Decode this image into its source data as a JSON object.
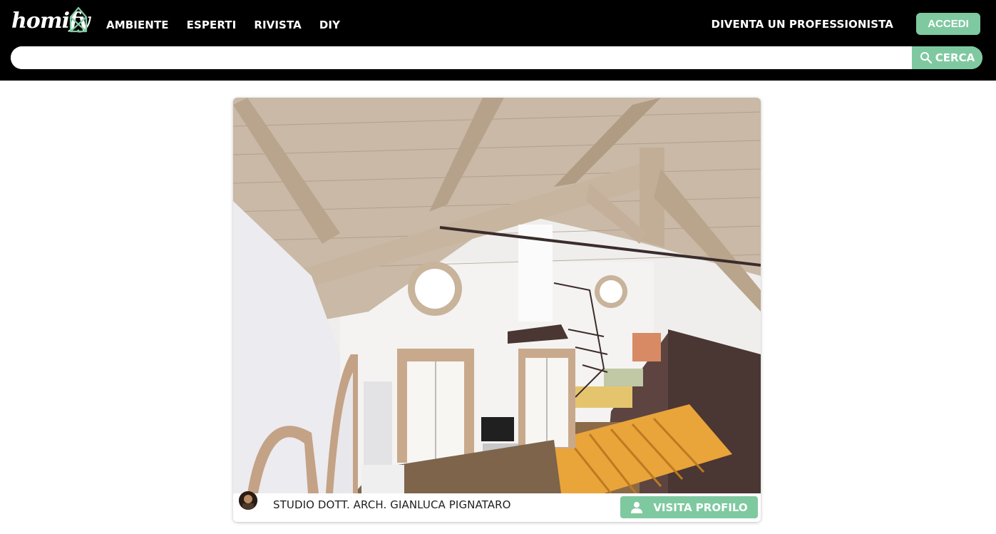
{
  "header": {
    "logo_text": "homify",
    "nav": [
      "AMBIENTE",
      "ESPERTI",
      "RIVISTA",
      "DIY"
    ],
    "pro_link": "DIVENTA UN PROFESSIONISTA",
    "login_label": "ACCEDI"
  },
  "search": {
    "value": "",
    "placeholder": "",
    "button_label": "CERCA"
  },
  "card": {
    "studio_name": "STUDIO DOTT. ARCH. GIANLUCA PIGNATARO",
    "profile_button_label": "VISITA PROFILO"
  },
  "colors": {
    "header_bg": "#000000",
    "accent": "#7fc9a0",
    "text": "#1f1f1f"
  },
  "icons": [
    "house-logo-icon",
    "search-icon",
    "user-icon"
  ]
}
